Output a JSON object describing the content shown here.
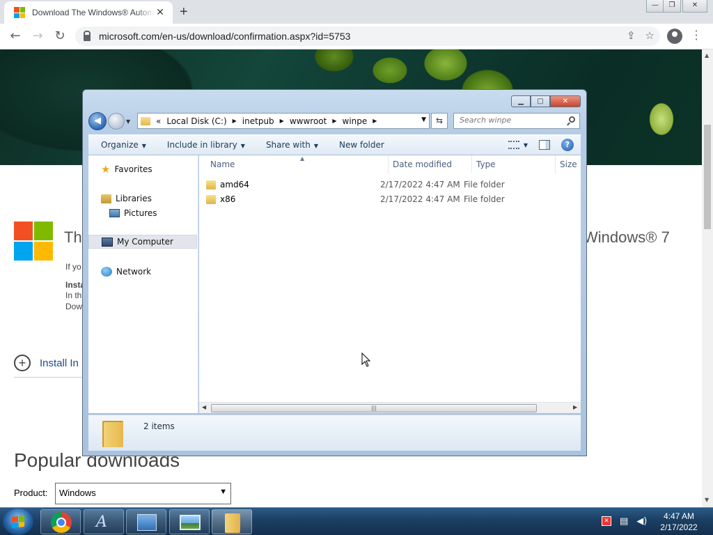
{
  "browser": {
    "tab_title": "Download The Windows® Automated Installation Kit",
    "tab_close": "✕",
    "new_tab": "+",
    "url": "microsoft.com/en-us/download/confirmation.aspx?id=5753",
    "window_controls": {
      "minimize": "—",
      "restore": "❐",
      "close": "✕"
    }
  },
  "webpage": {
    "heading_left": "Tha",
    "heading_right": "Windows® 7",
    "para_lines": [
      "If yo",
      "Insta",
      "In th",
      "Dow"
    ],
    "install_label": "Install In",
    "popular_title": "Popular downloads",
    "product_label": "Product:",
    "product_value": "Windows"
  },
  "explorer": {
    "breadcrumb": [
      "Local Disk (C:)",
      "inetpub",
      "wwwroot",
      "winpe"
    ],
    "search_placeholder": "Search winpe",
    "commands": [
      "Organize",
      "Include in library",
      "Share with",
      "New folder"
    ],
    "nav": {
      "favorites": "Favorites",
      "libraries": "Libraries",
      "pictures": "Pictures",
      "my_computer": "My Computer",
      "network": "Network"
    },
    "columns": [
      "Name",
      "Date modified",
      "Type",
      "Size"
    ],
    "files": [
      {
        "name": "amd64",
        "date": "2/17/2022 4:47 AM",
        "type": "File folder"
      },
      {
        "name": "x86",
        "date": "2/17/2022 4:47 AM",
        "type": "File folder"
      }
    ],
    "item_count": "2 items"
  },
  "taskbar": {
    "time": "4:47 AM",
    "date": "2/17/2022"
  }
}
